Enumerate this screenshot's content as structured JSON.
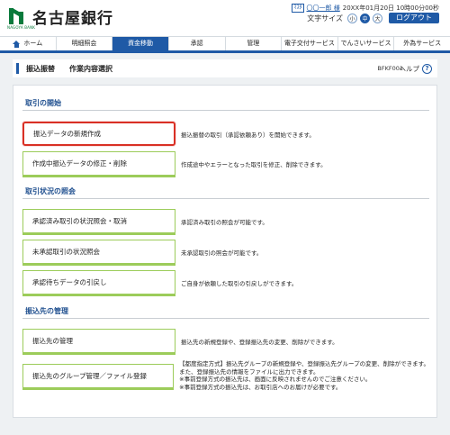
{
  "brand": {
    "name": "名古屋銀行",
    "sub": "NAGOYA BANK"
  },
  "user": {
    "badge": "ﾏｽﾀ",
    "name": "〇〇一郎 様",
    "datetime": "20XX年01月20日 10時00分00秒"
  },
  "font_size": {
    "label": "文字サイズ",
    "small": "小",
    "medium": "中",
    "large": "大",
    "selected": "中"
  },
  "logout": "ログアウト",
  "nav": {
    "items": [
      {
        "label": "ホーム",
        "active": false,
        "icon": "home-icon"
      },
      {
        "label": "明細照会",
        "active": false
      },
      {
        "label": "資金移動",
        "active": true
      },
      {
        "label": "承認",
        "active": false
      },
      {
        "label": "管理",
        "active": false
      },
      {
        "label": "電子交付サービス",
        "active": false
      },
      {
        "label": "でんさいサービス",
        "active": false
      },
      {
        "label": "外為サービス",
        "active": false
      }
    ]
  },
  "page": {
    "title": "振込振替",
    "subtitle": "作業内容選択",
    "screen_id": "BFKF001",
    "help": "ヘルプ"
  },
  "sections": {
    "start": {
      "heading": "取引の開始",
      "rows": [
        {
          "button": "振込データの新規作成",
          "desc": "振込振替の取引（承認依頼あり）を開始できます。"
        },
        {
          "button": "作成中振込データの修正・削除",
          "desc": "作成途中やエラーとなった取引を修正、削除できます。"
        }
      ]
    },
    "status": {
      "heading": "取引状況の照会",
      "rows": [
        {
          "button": "承認済み取引の状況照会・取消",
          "desc": "承認済み取引の照会が可能です。"
        },
        {
          "button": "未承認取引の状況照会",
          "desc": "未承認取引の照会が可能です。"
        },
        {
          "button": "承認待ちデータの引戻し",
          "desc": "ご自身が依頼した取引の引戻しができます。"
        }
      ]
    },
    "payee": {
      "heading": "振込先の管理",
      "rows": [
        {
          "button": "振込先の管理",
          "desc": "振込先の新規登録や、登録振込先の変更、削除ができます。"
        },
        {
          "button": "振込先のグループ管理／ファイル登録",
          "desc_lines": [
            "【都度指定方式】振込先グループの新規登録や、登録振込先グループの変更、削除ができます。",
            "また、登録振込先の情報をファイルに出力できます。",
            "※事前登録方式の振込先は、画面に反映されませんのでご注意ください。",
            "※事前登録方式の振込先は、お取引店へのお届けが必要です。"
          ]
        }
      ]
    }
  },
  "colors": {
    "primary": "#1f5aa6",
    "brand_green": "#0a7a3c",
    "button_border": "#9ccc5a",
    "highlight": "#d93025"
  }
}
